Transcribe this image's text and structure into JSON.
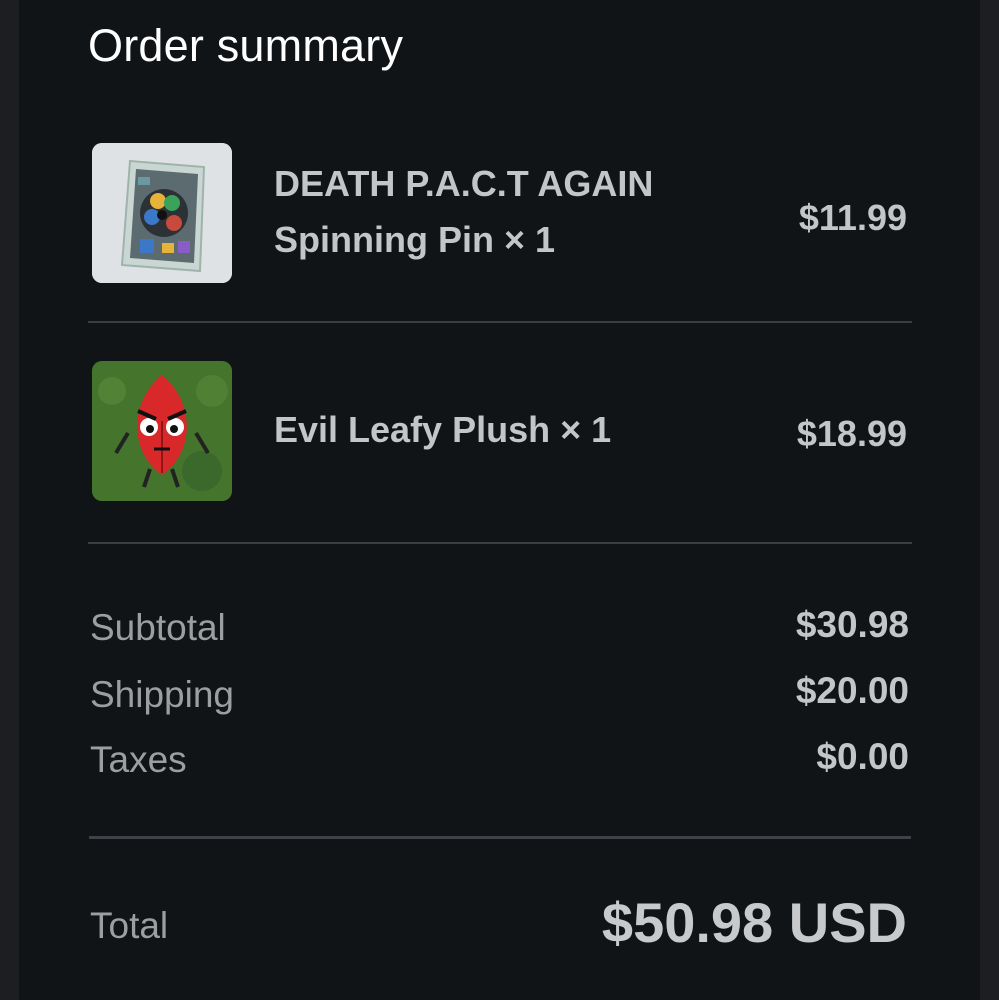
{
  "title": "Order summary",
  "items": [
    {
      "name_line1": "DEATH P.A.C.T AGAIN",
      "name_line2": "Spinning Pin × 1",
      "price": "$11.99",
      "image": "spinning-pin-photo"
    },
    {
      "name_line1": "Evil Leafy Plush × 1",
      "price": "$18.99",
      "image": "evil-leafy-plush-photo"
    }
  ],
  "summary": {
    "subtotal_label": "Subtotal",
    "subtotal_value": "$30.98",
    "shipping_label": "Shipping",
    "shipping_value": "$20.00",
    "taxes_label": "Taxes",
    "taxes_value": "$0.00"
  },
  "total": {
    "label": "Total",
    "value": "$50.98 USD"
  },
  "colors": {
    "background": "#111417",
    "text_primary": "#c3c5c7",
    "text_secondary": "#9c9fa2",
    "divider": "#3a3d41"
  }
}
